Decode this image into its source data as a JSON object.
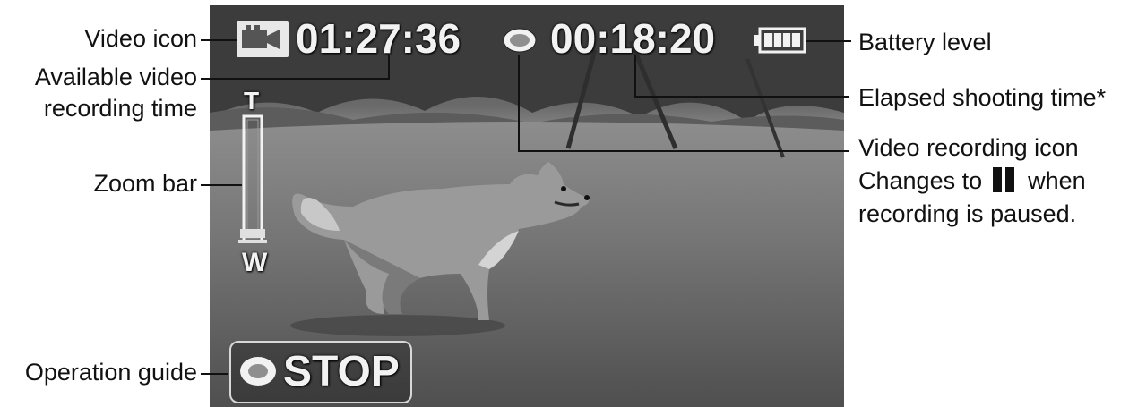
{
  "screen": {
    "available_time": "01:27:36",
    "elapsed_time": "00:18:20",
    "zoom_tele_label": "T",
    "zoom_wide_label": "W",
    "guide_label": "STOP",
    "battery_level_fraction": 1.0,
    "icons": [
      "video-camera-icon",
      "record-circle-icon",
      "battery-icon",
      "guide-circle-icon"
    ]
  },
  "callouts": {
    "video_icon": "Video icon",
    "available_time_line1": "Available video",
    "available_time_line2": "recording time",
    "zoom_bar": "Zoom bar",
    "operation_guide": "Operation guide",
    "battery_level": "Battery level",
    "elapsed_time": "Elapsed shooting time*",
    "rec_icon_line1": "Video recording icon",
    "rec_icon_line2_pre": "Changes to",
    "rec_icon_line2_post": "when",
    "rec_icon_line3": "recording is paused."
  }
}
